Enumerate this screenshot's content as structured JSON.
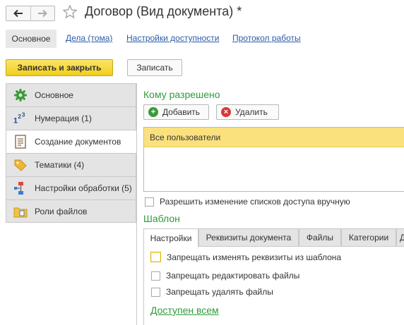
{
  "window": {
    "title": "Договор (Вид документа) *",
    "back_icon": "arrow-left-icon",
    "forward_icon": "arrow-right-icon",
    "favorite_icon": "star-icon"
  },
  "top_tabs": {
    "active": "Основное",
    "links": [
      "Дела (тома)",
      "Настройки доступности",
      "Протокол работы"
    ]
  },
  "toolbar": {
    "save_close_label": "Записать и закрыть",
    "save_label": "Записать"
  },
  "sidebar": {
    "items": [
      {
        "label": "Основное",
        "icon": "gear-icon",
        "active": false
      },
      {
        "label": "Нумерация (1)",
        "icon": "numbering-icon",
        "active": false
      },
      {
        "label": "Создание документов",
        "icon": "document-icon",
        "active": true
      },
      {
        "label": "Тематики (4)",
        "icon": "tag-icon",
        "active": false
      },
      {
        "label": "Настройки обработки (5)",
        "icon": "workflow-icon",
        "active": false
      },
      {
        "label": "Роли файлов",
        "icon": "folder-icon",
        "active": false
      }
    ]
  },
  "access": {
    "title": "Кому разрешено",
    "add_label": "Добавить",
    "delete_label": "Удалить",
    "rows": [
      "Все пользователи"
    ],
    "allow_manual_label": "Разрешить изменение списков доступа вручную"
  },
  "template": {
    "title": "Шаблон",
    "tabs": [
      "Настройки",
      "Реквизиты документа",
      "Файлы",
      "Категории",
      "Д"
    ],
    "active_tab": "Настройки",
    "options": [
      "Запрещать изменять реквизиты из шаблона",
      "Запрещать редактировать файлы",
      "Запрещать удалять файлы"
    ],
    "available_title": "Доступен всем"
  },
  "colors": {
    "accent_green": "#2d9c3b",
    "primary_button": "#f2ce19",
    "selected_row": "#fbe17d",
    "link": "#2b5ba8"
  }
}
